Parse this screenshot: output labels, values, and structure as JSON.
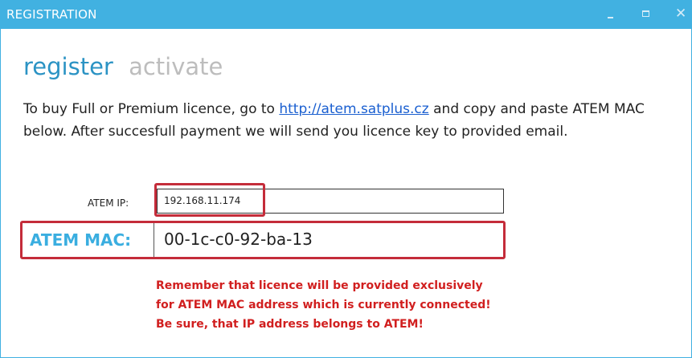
{
  "window": {
    "title": "REGISTRATION",
    "accent_color": "#41b1e1",
    "controls": {
      "minimize": "minimize-icon",
      "maximize": "maximize-icon",
      "close": "close-icon"
    }
  },
  "tabs": [
    {
      "label": "register",
      "active": true
    },
    {
      "label": "activate",
      "active": false
    }
  ],
  "description": {
    "before_link": "To buy Full or Premium licence, go to ",
    "link": "http://atem.satplus.cz",
    "after_link": " and copy and paste ATEM MAC below. After succesfull payment we will send you licence key to provided email."
  },
  "form": {
    "ip_label": "ATEM IP:",
    "ip_value": "192.168.11.174",
    "mac_label": "ATEM MAC:",
    "mac_value": "00-1c-c0-92-ba-13"
  },
  "warning": {
    "lines": [
      "Remember that licence will be provided exclusively",
      "for ATEM MAC address which is currently connected!",
      "Be sure, that IP address belongs to ATEM!"
    ],
    "color": "#d11f1f"
  },
  "highlight_color": "#c42c3a"
}
